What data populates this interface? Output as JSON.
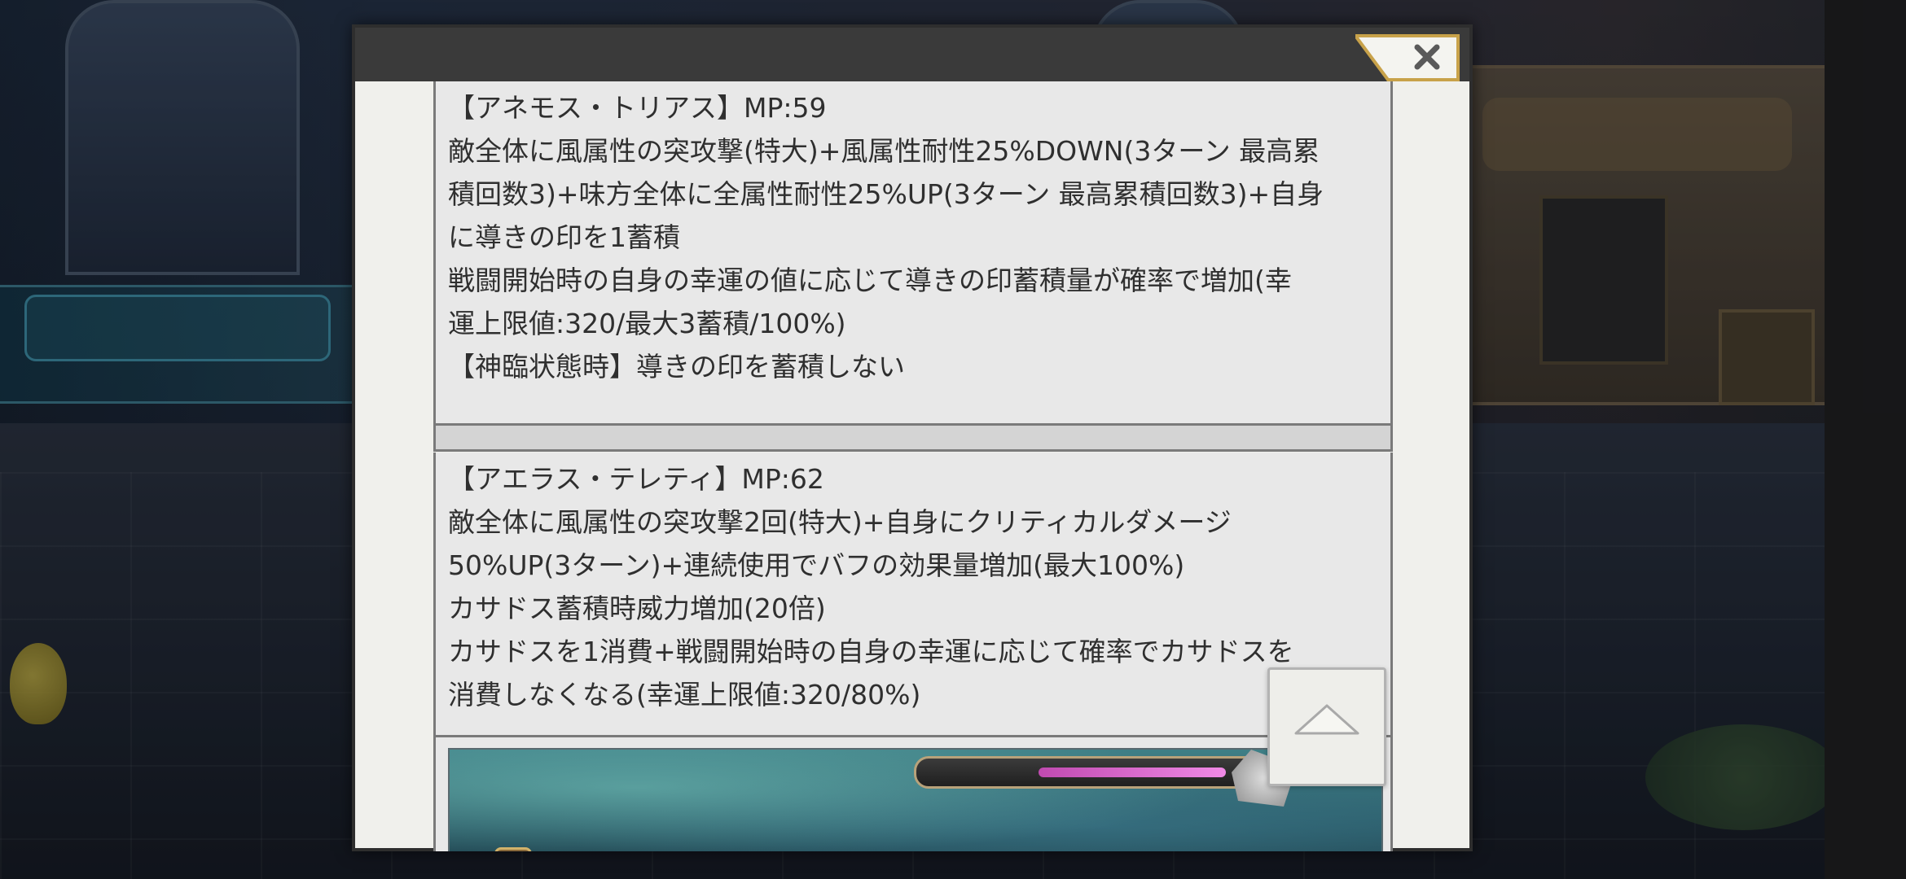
{
  "skills": [
    {
      "title": "【アネモス・トリアス】MP:59",
      "lines": [
        "敵全体に風属性の突攻撃(特大)+風属性耐性25%DOWN(3ターン 最高累",
        "積回数3)+味方全体に全属性耐性25%UP(3ターン 最高累積回数3)+自身",
        "に導きの印を1蓄積",
        "戦闘開始時の自身の幸運の値に応じて導きの印蓄積量が確率で増加(幸",
        "運上限値:320/最大3蓄積/100%)",
        "【神臨状態時】導きの印を蓄積しない"
      ]
    },
    {
      "title": "【アエラス・テレティ】MP:62",
      "lines": [
        "敵全体に風属性の突攻撃2回(特大)+自身にクリティカルダメージ",
        "50%UP(3ターン)+連続使用でバフの効果量増加(最大100%)",
        "カサドス蓄積時威力増加(20倍)",
        "カサドスを1消費+戦闘開始時の自身の幸運に応じて確率でカサドスを",
        "消費しなくなる(幸運上限値:320/80%)"
      ]
    }
  ],
  "icons": {
    "close": "close-icon",
    "scroll_top": "chevron-up-icon"
  },
  "colors": {
    "dialog_bg": "#f0f0ec",
    "card_bg": "#e8e8e8",
    "header_bg": "#3a3a3a",
    "gauge_fill": "#e07ad6"
  }
}
